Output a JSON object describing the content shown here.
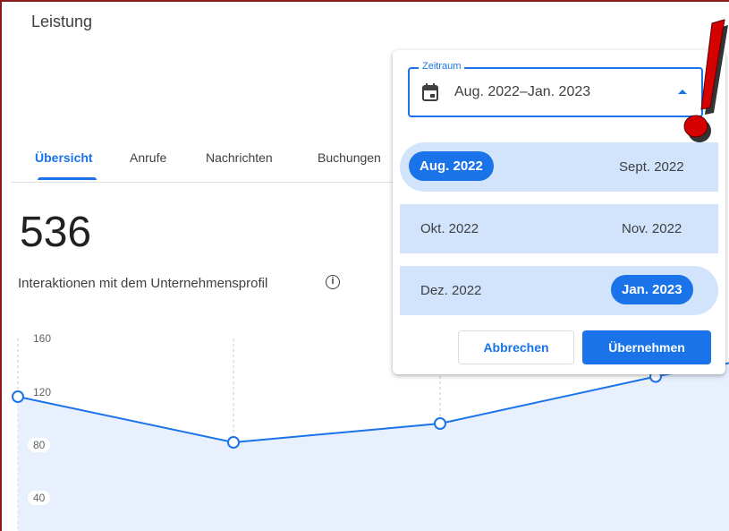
{
  "page": {
    "title": "Leistung"
  },
  "tabs": [
    {
      "label": "Übersicht",
      "active": true
    },
    {
      "label": "Anrufe",
      "active": false
    },
    {
      "label": "Nachrichten",
      "active": false
    },
    {
      "label": "Buchungen",
      "active": false
    }
  ],
  "metric": {
    "value": "536",
    "label": "Interaktionen mit dem Unternehmensprofil",
    "info_icon": "info-icon"
  },
  "chart_data": {
    "type": "area",
    "y_ticks": [
      "160",
      "120",
      "80",
      "40"
    ],
    "ylim": [
      0,
      160
    ],
    "points": [
      {
        "index": 0,
        "value": 102
      },
      {
        "index": 1,
        "value": 68
      },
      {
        "index": 2,
        "value": 82
      },
      {
        "index": 3,
        "value": 117
      },
      {
        "index": 4,
        "value": 127
      }
    ],
    "grid": "vertical-dashed",
    "colors": {
      "line": "#1a73e8",
      "fill": "#e8f0fe"
    }
  },
  "date_picker": {
    "legend": "Zeitraum",
    "value": "Aug. 2022–Jan. 2023",
    "months": [
      [
        "Aug. 2022",
        "Sept. 2022"
      ],
      [
        "Okt. 2022",
        "Nov. 2022"
      ],
      [
        "Dez. 2022",
        "Jan. 2023"
      ]
    ],
    "selected_start": "Aug. 2022",
    "selected_end": "Jan. 2023",
    "cancel_label": "Abbrechen",
    "apply_label": "Übernehmen"
  },
  "colors": {
    "accent": "#1a73e8",
    "range_band": "#d2e3fc",
    "annotation": "#d50000"
  }
}
